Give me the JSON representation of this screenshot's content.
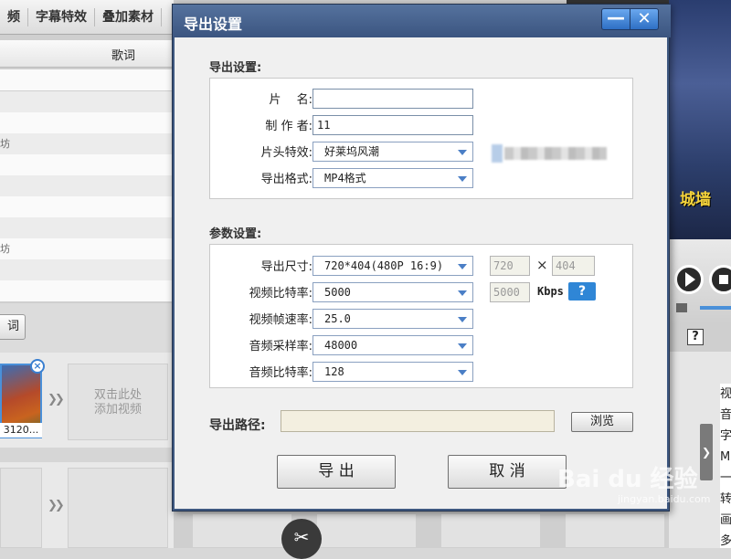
{
  "background": {
    "tabs": [
      "频",
      "字幕特效",
      "叠加素材"
    ],
    "list_header": "歌词",
    "row_fragments": [
      "坊",
      "坊"
    ],
    "lyric_button": "词",
    "thumb_label": "3120...",
    "add_video_text": [
      "双击此处",
      "添加视频"
    ],
    "preview_title": "城墙",
    "right_list": [
      "视",
      "音",
      "字",
      "M",
      "一",
      "转",
      "画",
      "多"
    ],
    "watermark": "Bai du 经验",
    "watermark_sub": "jingyan.baidu.com",
    "icons": {
      "close": "close-circle-icon",
      "scissors": "scissors-icon",
      "play": "play-icon",
      "stop": "stop-icon",
      "volume": "volume-icon",
      "help": "help-icon",
      "expand": "chevron-right-icon"
    }
  },
  "dialog": {
    "title": "导出设置",
    "minimize_symbol": "—",
    "close_symbol": "✕",
    "export_section": {
      "title": "导出设置:",
      "film_name_label": "片　 名:",
      "film_name_value": "",
      "author_label": "制 作 者:",
      "author_value": "11",
      "intro_effect_label": "片头特效:",
      "intro_effect_value": "好莱坞风潮",
      "format_label": "导出格式:",
      "format_value": "MP4格式"
    },
    "param_section": {
      "title": "参数设置:",
      "size_label": "导出尺寸:",
      "size_value": "720*404(480P 16:9)",
      "width": "720",
      "times": "×",
      "height": "404",
      "video_bitrate_label": "视频比特率:",
      "video_bitrate_value": "5000",
      "video_bitrate_custom": "5000",
      "kbps": "Kbps",
      "help": "?",
      "framerate_label": "视频帧速率:",
      "framerate_value": "25.0",
      "samplerate_label": "音频采样率:",
      "samplerate_value": "48000",
      "audio_bitrate_label": "音频比特率:",
      "audio_bitrate_value": "128"
    },
    "path_label": "导出路径:",
    "path_value": "",
    "browse_button": "浏览",
    "export_button": "导 出",
    "cancel_button": "取 消",
    "colors": {
      "titlebar": "#3e5880",
      "accent": "#2f86d6"
    }
  }
}
